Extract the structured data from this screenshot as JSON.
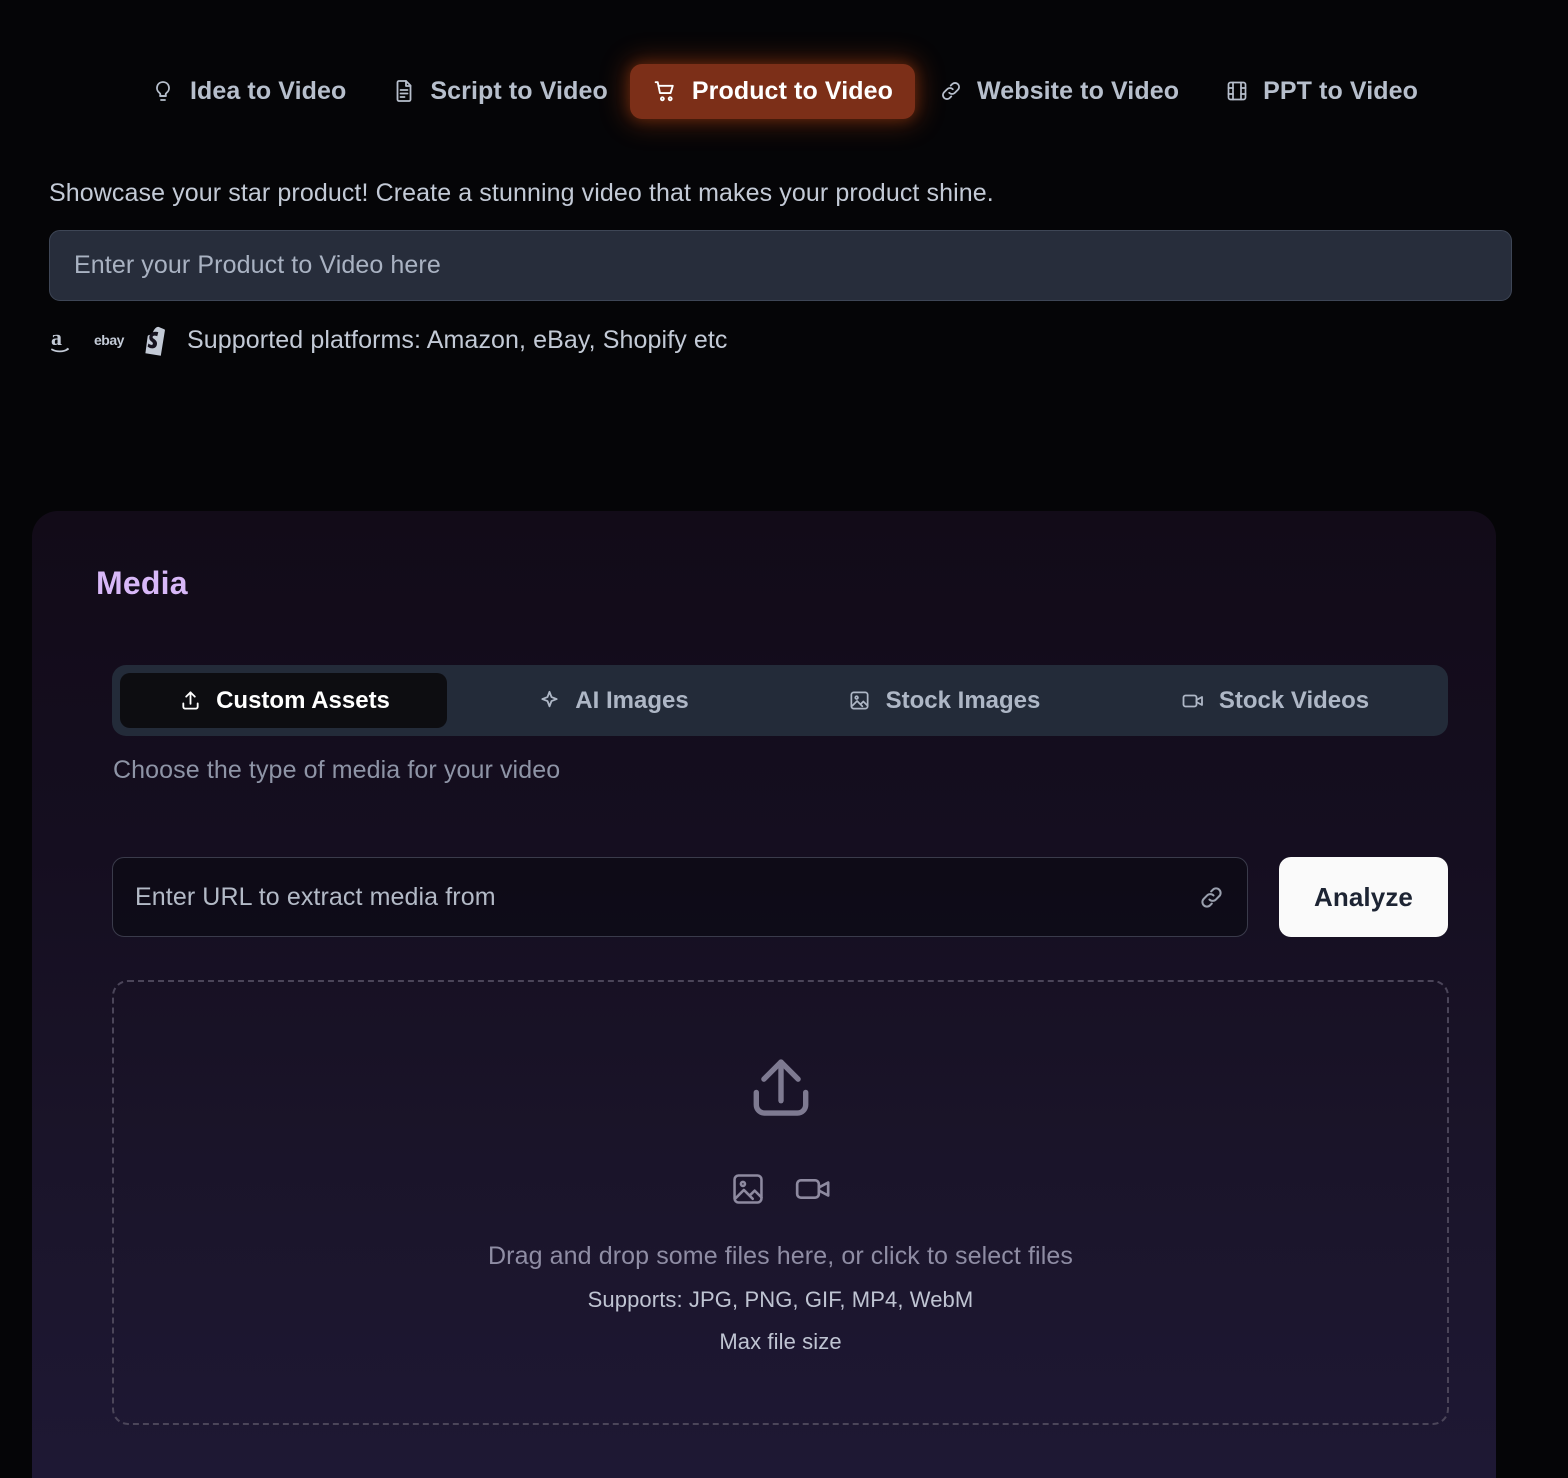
{
  "top_tabs": [
    {
      "label": "Idea to Video",
      "icon": "lightbulb-icon",
      "active": false
    },
    {
      "label": "Script to Video",
      "icon": "document-icon",
      "active": false
    },
    {
      "label": "Product to Video",
      "icon": "shopping-cart-icon",
      "active": true
    },
    {
      "label": "Website to Video",
      "icon": "link-icon",
      "active": false
    },
    {
      "label": "PPT to Video",
      "icon": "film-strip-icon",
      "active": false
    }
  ],
  "hero": {
    "subtitle": "Showcase your star product! Create a stunning video that makes your product shine.",
    "input_placeholder": "Enter your Product to Video here",
    "input_value": ""
  },
  "platforms": {
    "text": "Supported platforms: Amazon, eBay, Shopify etc",
    "icons": [
      "amazon-icon",
      "ebay-icon",
      "shopify-icon"
    ]
  },
  "media": {
    "title": "Media",
    "hint": "Choose the type of media for your video",
    "tabs": [
      {
        "label": "Custom Assets",
        "icon": "upload-icon",
        "active": true
      },
      {
        "label": "AI Images",
        "icon": "sparkle-icon",
        "active": false
      },
      {
        "label": "Stock Images",
        "icon": "image-icon",
        "active": false
      },
      {
        "label": "Stock Videos",
        "icon": "video-camera-icon",
        "active": false
      }
    ],
    "url": {
      "placeholder": "Enter URL to extract media from",
      "value": "",
      "icon": "link-icon"
    },
    "analyze_label": "Analyze",
    "dropzone": {
      "main_text": "Drag and drop some files here, or click to select files",
      "supports_text": "Supports: JPG, PNG, GIF, MP4, WebM",
      "max_size_text": "Max file size",
      "icons": [
        "upload-icon",
        "image-icon",
        "video-camera-icon"
      ]
    }
  },
  "colors": {
    "page_bg": "#050507",
    "active_tab_bg": "#7c2f18",
    "media_title": "#d8b8f8",
    "analyze_bg": "#fafafa",
    "media_tabbar_bg": "#232b39",
    "input_bg": "#272d3b"
  }
}
